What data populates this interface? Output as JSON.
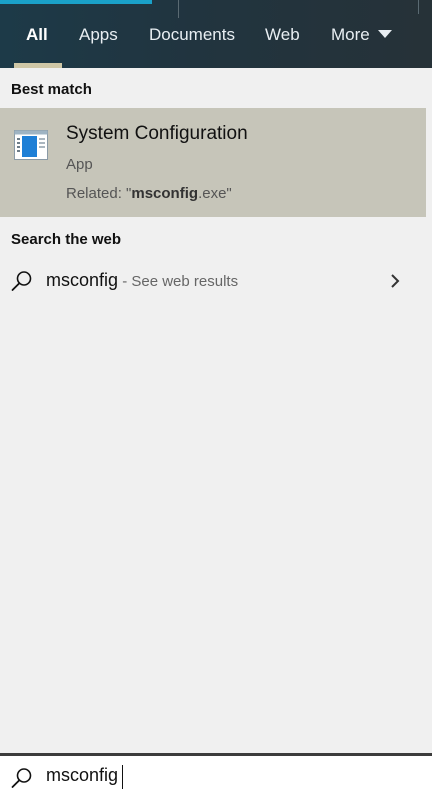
{
  "tabs": [
    {
      "label": "All",
      "active": true
    },
    {
      "label": "Apps"
    },
    {
      "label": "Documents"
    },
    {
      "label": "Web"
    },
    {
      "label": "More"
    }
  ],
  "best_match": {
    "heading": "Best match",
    "title": "System Configuration",
    "type": "App",
    "related_prefix": "Related: \"",
    "related_bold": "msconfig",
    "related_suffix": ".exe\"",
    "icon": "system-configuration-icon"
  },
  "web": {
    "heading": "Search the web",
    "query": "msconfig",
    "suffix": " - See web results",
    "icon": "search-icon"
  },
  "search": {
    "value": "msconfig",
    "icon": "search-icon"
  },
  "colors": {
    "accent": "#1aa1c9",
    "selected_bg": "#c6c5b9",
    "tab_underline": "#cfc7a6"
  }
}
